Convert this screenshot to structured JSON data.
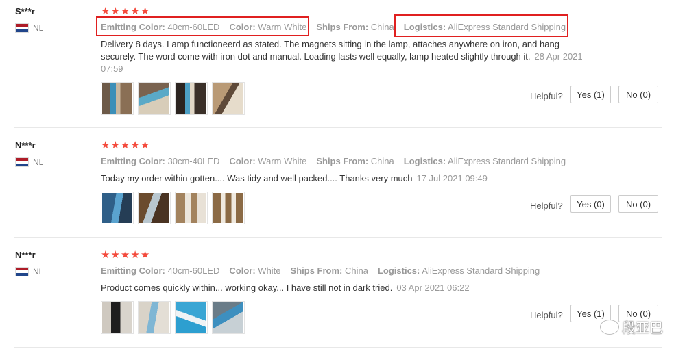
{
  "helpful_label": "Helpful?",
  "labels": {
    "color_key": "Emitting Color:",
    "color2_key": "Color:",
    "ships_key": "Ships From:",
    "logistics_key": "Logistics:"
  },
  "colors": {
    "star": "#f44a3c",
    "highlight": "#e02020"
  },
  "reviews": [
    {
      "user": "S***r",
      "country": "NL",
      "rating": 5,
      "emitting_color": "40cm-60LED",
      "color": "Warm White",
      "ships_from": "China",
      "logistics": "AliExpress Standard Shipping",
      "text": "Delivery 8 days. Lamp functioneerd as stated. The magnets sitting in the lamp, attaches anywhere on iron, and hang securely. The word come with iron dot and manual. Loading lasts well equally, lamp heated slightly through it.",
      "date": "28 Apr 2021 07:59",
      "yes": "Yes (1)",
      "no": "No (0)"
    },
    {
      "user": "N***r",
      "country": "NL",
      "rating": 5,
      "emitting_color": "30cm-40LED",
      "color": "Warm White",
      "ships_from": "China",
      "logistics": "AliExpress Standard Shipping",
      "text": "Today my order within gotten.... Was tidy and well packed.... Thanks very much",
      "date": "17 Jul 2021 09:49",
      "yes": "Yes (0)",
      "no": "No (0)"
    },
    {
      "user": "N***r",
      "country": "NL",
      "rating": 5,
      "emitting_color": "40cm-60LED",
      "color": "White",
      "ships_from": "China",
      "logistics": "AliExpress Standard Shipping",
      "text": "Product comes quickly within... working okay... I have still not in dark tried.",
      "date": "03 Apr 2021 06:22",
      "yes": "Yes (1)",
      "no": "No (0)"
    }
  ],
  "watermark": "段亚巴"
}
